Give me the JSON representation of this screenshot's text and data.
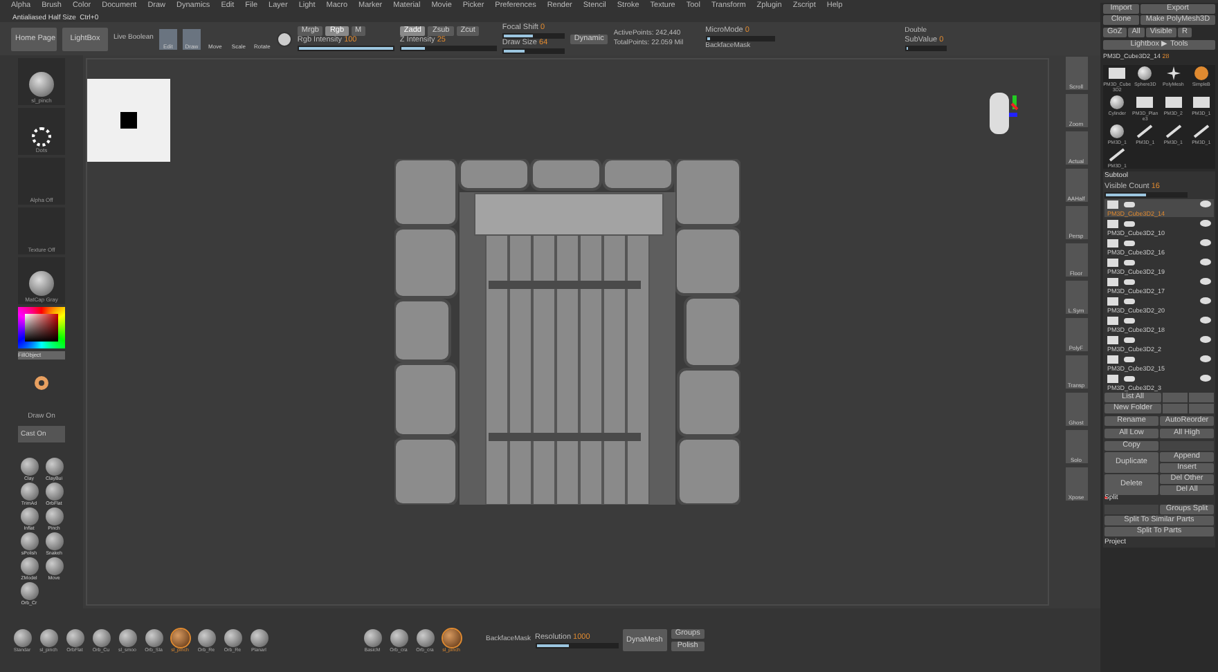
{
  "menu": [
    "Alpha",
    "Brush",
    "Color",
    "Document",
    "Draw",
    "Dynamics",
    "Edit",
    "File",
    "Layer",
    "Light",
    "Macro",
    "Marker",
    "Material",
    "Movie",
    "Picker",
    "Preferences",
    "Render",
    "Stencil",
    "Stroke",
    "Texture",
    "Tool",
    "Transform",
    "Zplugin",
    "Zscript",
    "Help"
  ],
  "status": "Antialiased Half Size  Ctrl+0",
  "toolbar": {
    "buttons": [
      "Home Page",
      "LightBox"
    ],
    "live_boolean": "Live Boolean",
    "tools": [
      {
        "label": "Edit",
        "selected": true
      },
      {
        "label": "Draw",
        "selected": true
      },
      {
        "label": "Move",
        "selected": false
      },
      {
        "label": "Scale",
        "selected": false
      },
      {
        "label": "Rotate",
        "selected": false
      }
    ],
    "rgb": {
      "modes": [
        {
          "label": "Mrgb",
          "selected": false
        },
        {
          "label": "Rgb",
          "selected": true
        },
        {
          "label": "M",
          "selected": false
        }
      ],
      "slider": {
        "label": "Rgb Intensity",
        "value": "100",
        "level": 1
      }
    },
    "z": {
      "modes": [
        {
          "label": "Zadd",
          "selected": true
        },
        {
          "label": "Zsub",
          "selected": false
        },
        {
          "label": "Zcut",
          "selected": false
        }
      ],
      "slider": {
        "label": "Z Intensity",
        "value": "25",
        "level": 0.25
      }
    },
    "brush_sliders": [
      {
        "label": "Focal Shift",
        "value": "0",
        "level": 0.5
      },
      {
        "label": "Draw Size",
        "value": "64",
        "level": 0.35
      }
    ],
    "dynamic": "Dynamic",
    "points": [
      "ActivePoints: 242,440",
      "TotalPoints: 22.059 Mil"
    ],
    "micro": {
      "label": "MicroMode",
      "value": "0",
      "level": 0.05
    },
    "backface": "BackfaceMask",
    "double": "Double",
    "sub": {
      "label": "SubValue",
      "value": "0",
      "level": 0.05
    }
  },
  "left": {
    "brush": "sl_pinch",
    "stroke": "Dots",
    "alpha": "Alpha Off",
    "texture": "Texture Off",
    "material": "MatCap Gray",
    "gradient": "FillObject",
    "draw_toggle": "Draw On",
    "cast_toggle": "Cast On",
    "shelf": [
      "Clay",
      "ClayBui",
      "TrimAd",
      "OrbFlat",
      "Inflat",
      "Pinch",
      "sPolish",
      "Snakeh",
      "ZModel",
      "Move",
      "Orb_Cr"
    ]
  },
  "bottom": {
    "brushes": [
      {
        "label": "Standar",
        "selected": false
      },
      {
        "label": "sl_pinch",
        "selected": false
      },
      {
        "label": "OrbFlat",
        "selected": false
      },
      {
        "label": "Orb_Cu",
        "selected": false
      },
      {
        "label": "sl_smoo",
        "selected": false
      },
      {
        "label": "Orb_Sla",
        "selected": false
      },
      {
        "label": "sl_pinch",
        "selected": true
      },
      {
        "label": "Orb_Re",
        "selected": false
      },
      {
        "label": "Orb_Re",
        "selected": false
      },
      {
        "label": "Planarl",
        "selected": false
      }
    ],
    "materials": [
      {
        "label": "BasicM",
        "selected": false
      },
      {
        "label": "Orb_cra",
        "selected": false
      },
      {
        "label": "Orb_cra",
        "selected": false
      },
      {
        "label": "sl_pinch",
        "selected": true
      }
    ],
    "mask": "BackfaceMask",
    "resolution": {
      "label": "Resolution",
      "value": "1000",
      "level": 0.4
    },
    "dynamesh": "DynaMesh",
    "groups": "Groups",
    "polish": "Polish"
  },
  "strip": [
    "Scroll",
    "Zoom",
    "Actual",
    "AAHalf",
    "Persp",
    "Floor",
    "L.Sym",
    "PolyF",
    "Transp",
    "Ghost",
    "Solo",
    "Xpose"
  ],
  "tool": {
    "buttons": [
      "Import",
      "Export",
      "Clone",
      "Make PolyMesh3D",
      "GoZ",
      "All",
      "Visible",
      "R"
    ],
    "lightbox": "Lightbox ▶ Tools",
    "current": "PM3D_Cube3D2_14",
    "count": "28",
    "thumbs": [
      {
        "label": "PM3D_Cube3D2",
        "kind": "flat"
      },
      {
        "label": "Sphere3D",
        "kind": "sphere"
      },
      {
        "label": "PolyMesh",
        "kind": "star"
      },
      {
        "label": "SimpleB",
        "kind": "s"
      },
      {
        "label": "Cylinder",
        "kind": "sphere"
      },
      {
        "label": "PM3D_Plane3",
        "kind": "flat"
      },
      {
        "label": "PM3D_2",
        "kind": "flat"
      },
      {
        "label": "PM3D_1",
        "kind": "flat"
      },
      {
        "label": "PM3D_1",
        "kind": "sphere"
      },
      {
        "label": "PM3D_1",
        "kind": "stick"
      },
      {
        "label": "PM3D_1",
        "kind": "stick"
      },
      {
        "label": "PM3D_1",
        "kind": "stick"
      },
      {
        "label": "PM3D_1",
        "kind": "stick"
      }
    ]
  },
  "subtool": {
    "title": "Subtool",
    "visible_count": {
      "label": "Visible Count",
      "value": "16",
      "level": 0.5
    },
    "items": [
      {
        "name": "PM3D_Cube3D2_14",
        "selected": true
      },
      {
        "name": "PM3D_Cube3D2_10",
        "selected": false
      },
      {
        "name": "PM3D_Cube3D2_16",
        "selected": false
      },
      {
        "name": "PM3D_Cube3D2_19",
        "selected": false
      },
      {
        "name": "PM3D_Cube3D2_17",
        "selected": false
      },
      {
        "name": "PM3D_Cube3D2_20",
        "selected": false
      },
      {
        "name": "PM3D_Cube3D2_18",
        "selected": false
      },
      {
        "name": "PM3D_Cube3D2_2",
        "selected": false
      },
      {
        "name": "PM3D_Cube3D2_15",
        "selected": false
      },
      {
        "name": "PM3D_Cube3D2_3",
        "selected": false
      }
    ],
    "list_all": "List All",
    "new_folder": "New Folder",
    "rows": [
      [
        "Rename",
        "AutoReorder"
      ],
      [
        "All Low",
        "All High"
      ],
      [
        "Copy",
        ""
      ]
    ],
    "duplicate": "Duplicate",
    "dup_side": [
      "Append",
      "Insert"
    ],
    "delete": "Delete",
    "del_side": [
      "Del Other",
      "Del All"
    ]
  },
  "split": {
    "title": "Split",
    "groups_split": "Groups Split",
    "buttons": [
      "Split To Similar Parts",
      "Split To Parts"
    ]
  },
  "project": "Project"
}
